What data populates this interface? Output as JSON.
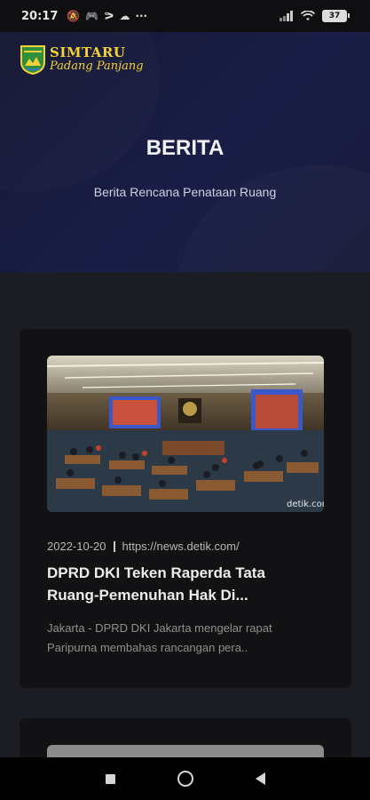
{
  "status_bar": {
    "time": "20:17",
    "battery": "37",
    "notification_icons": [
      "mute-icon",
      "game-icon",
      "shazam-icon",
      "cloud-icon",
      "more-icon"
    ]
  },
  "app": {
    "logo_title": "SIMTARU",
    "logo_subtitle": "Padang Panjang"
  },
  "page": {
    "title": "BERITA",
    "subtitle": "Berita Rencana Penataan Ruang"
  },
  "articles": [
    {
      "date": "2022-10-20",
      "source": "https://news.detik.com/",
      "title": "DPRD DKI Teken Raperda Tata Ruang-Pemenuhan Hak Di...",
      "excerpt": "Jakarta - DPRD DKI Jakarta mengelar rapat Paripurna membahas rancangan pera..",
      "image_watermark": "detik.com"
    }
  ],
  "colors": {
    "hero_bg": "#1a1e47",
    "logo_yellow": "#f3d13a",
    "card_bg": "#121214",
    "page_bg": "#1c1d22"
  }
}
